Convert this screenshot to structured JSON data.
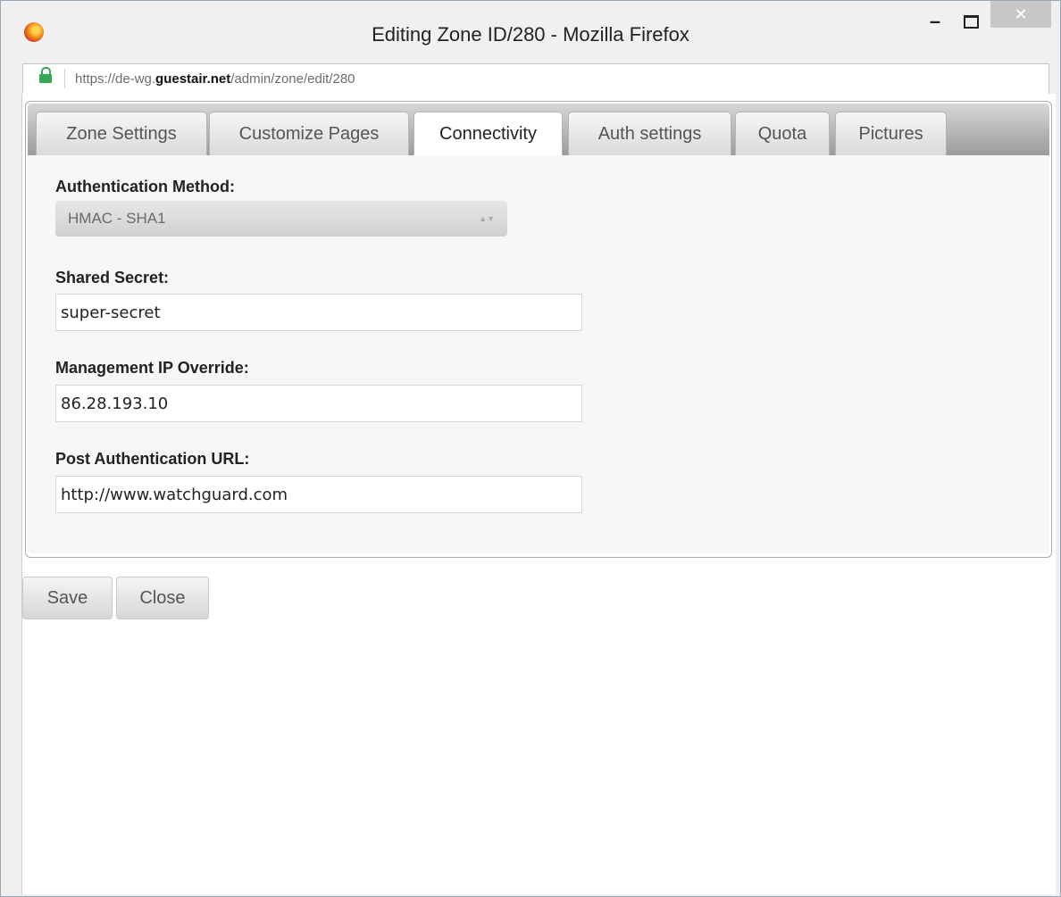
{
  "window": {
    "title": "Editing Zone ID/280 - Mozilla Firefox",
    "close_glyph": "✕",
    "minimize_glyph": "–"
  },
  "urlbar": {
    "url_prefix": "https://de-wg.",
    "url_domain": "guestair.net",
    "url_path": "/admin/zone/edit/280"
  },
  "tabs": [
    {
      "label": "Zone Settings",
      "active": false
    },
    {
      "label": "Customize Pages",
      "active": false
    },
    {
      "label": "Connectivity",
      "active": true
    },
    {
      "label": "Auth settings",
      "active": false
    },
    {
      "label": "Quota",
      "active": false
    },
    {
      "label": "Pictures",
      "active": false
    }
  ],
  "form": {
    "auth_method_label": "Authentication Method:",
    "auth_method_value": "HMAC - SHA1",
    "shared_secret_label": "Shared Secret:",
    "shared_secret_value": "super-secret",
    "mgmt_ip_label": "Management IP Override:",
    "mgmt_ip_value": "86.28.193.10",
    "post_auth_url_label": "Post Authentication URL:",
    "post_auth_url_value": "http://www.watchguard.com"
  },
  "actions": {
    "save_label": "Save",
    "close_label": "Close"
  },
  "colors": {
    "lock": "#34a853",
    "close_button": "#c7c7c7"
  }
}
